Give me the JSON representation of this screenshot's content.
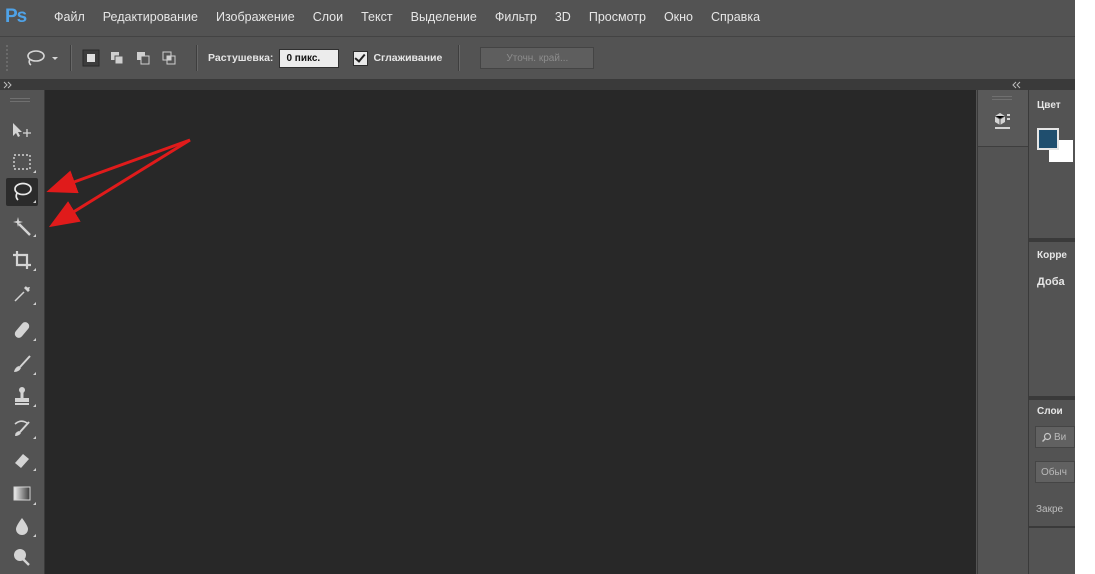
{
  "app": {
    "logo": "Ps"
  },
  "menu": {
    "items": [
      "Файл",
      "Редактирование",
      "Изображение",
      "Слои",
      "Текст",
      "Выделение",
      "Фильтр",
      "3D",
      "Просмотр",
      "Окно",
      "Справка"
    ]
  },
  "options": {
    "feather_label": "Растушевка:",
    "feather_value": "0 пикс.",
    "antialias_label": "Сглаживание",
    "antialias_checked": true,
    "refine_edge_label": "Уточн. край..."
  },
  "tools": [
    {
      "name": "move-tool",
      "icon": "move-icon"
    },
    {
      "name": "rectangular-marquee-tool",
      "icon": "marquee-icon"
    },
    {
      "name": "lasso-tool",
      "icon": "lasso-icon",
      "active": true
    },
    {
      "name": "magic-wand-tool",
      "icon": "magic-wand-icon"
    },
    {
      "name": "crop-tool",
      "icon": "crop-icon"
    },
    {
      "name": "eyedropper-tool",
      "icon": "eyedropper-icon"
    },
    {
      "name": "healing-brush-tool",
      "icon": "bandage-icon"
    },
    {
      "name": "brush-tool",
      "icon": "brush-icon"
    },
    {
      "name": "clone-stamp-tool",
      "icon": "stamp-icon"
    },
    {
      "name": "history-brush-tool",
      "icon": "history-brush-icon"
    },
    {
      "name": "eraser-tool",
      "icon": "eraser-icon"
    },
    {
      "name": "gradient-tool",
      "icon": "gradient-icon"
    },
    {
      "name": "blur-tool",
      "icon": "drop-icon"
    },
    {
      "name": "dodge-tool",
      "icon": "dodge-icon"
    }
  ],
  "panels": {
    "color_title": "Цвет",
    "color_swatch": "#1f4e6e",
    "adjustments_title": "Корре",
    "adjustments_sub": "Доба",
    "layers_title": "Слои",
    "layers_search": "Ви",
    "layers_blend": "Обыч",
    "layers_lock": "Закре"
  },
  "annotation": {
    "arrow_color": "#e01b1b"
  }
}
